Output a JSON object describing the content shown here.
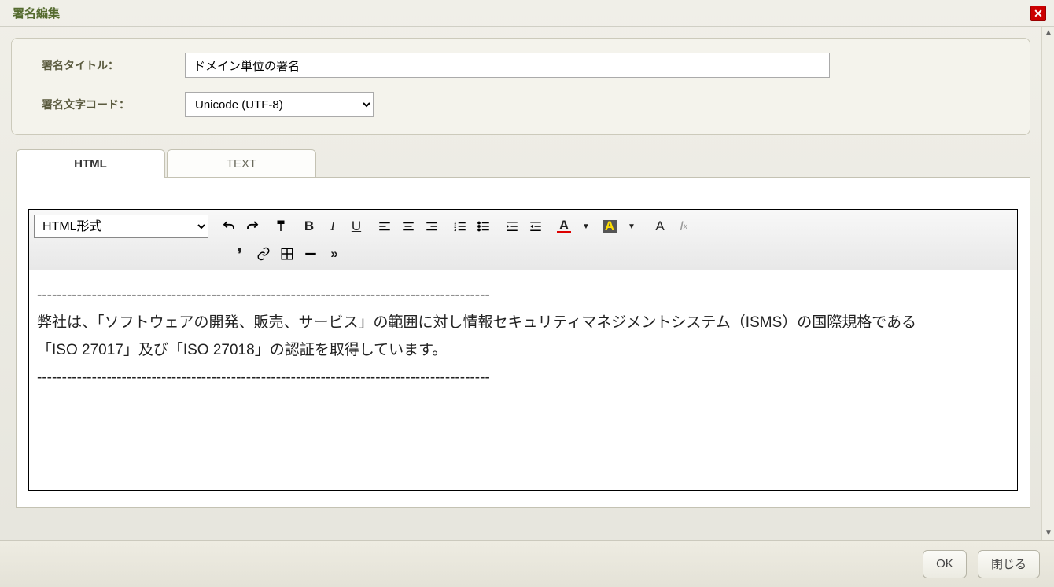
{
  "dialog": {
    "title": "署名編集",
    "close_label": "✕"
  },
  "form": {
    "title_label": "署名タイトル：",
    "title_value": "ドメイン単位の署名",
    "charset_label": "署名文字コード：",
    "charset_value": "Unicode (UTF-8)"
  },
  "tabs": {
    "html": "HTML",
    "text": "TEXT"
  },
  "editor": {
    "format_select": "HTML形式",
    "content": "-------------------------------------------------------------------------------------------\n弊社は、「ソフトウェアの開発、販売、サービス」の範囲に対し情報セキュリティマネジメントシステム（ISMS）の国際規格である\n「ISO 27017」及び「ISO 27018」の認証を取得しています。\n-------------------------------------------------------------------------------------------"
  },
  "toolbar": {
    "undo": "↶",
    "redo": "↷",
    "format_painter": "⊤",
    "bold": "B",
    "italic": "I",
    "underline": "U",
    "align_left": "≡",
    "align_center": "≡",
    "align_right": "≡",
    "ol": "≡",
    "ul": "≡",
    "indent_in": "⇥",
    "indent_out": "⇤",
    "text_color": "A",
    "bg_color": "A",
    "font": "A",
    "clear": "Ix",
    "quote": "❜",
    "link": "⧉",
    "table": "⊞",
    "hr": "—",
    "more": "≫"
  },
  "footer": {
    "ok": "OK",
    "close": "閉じる"
  }
}
